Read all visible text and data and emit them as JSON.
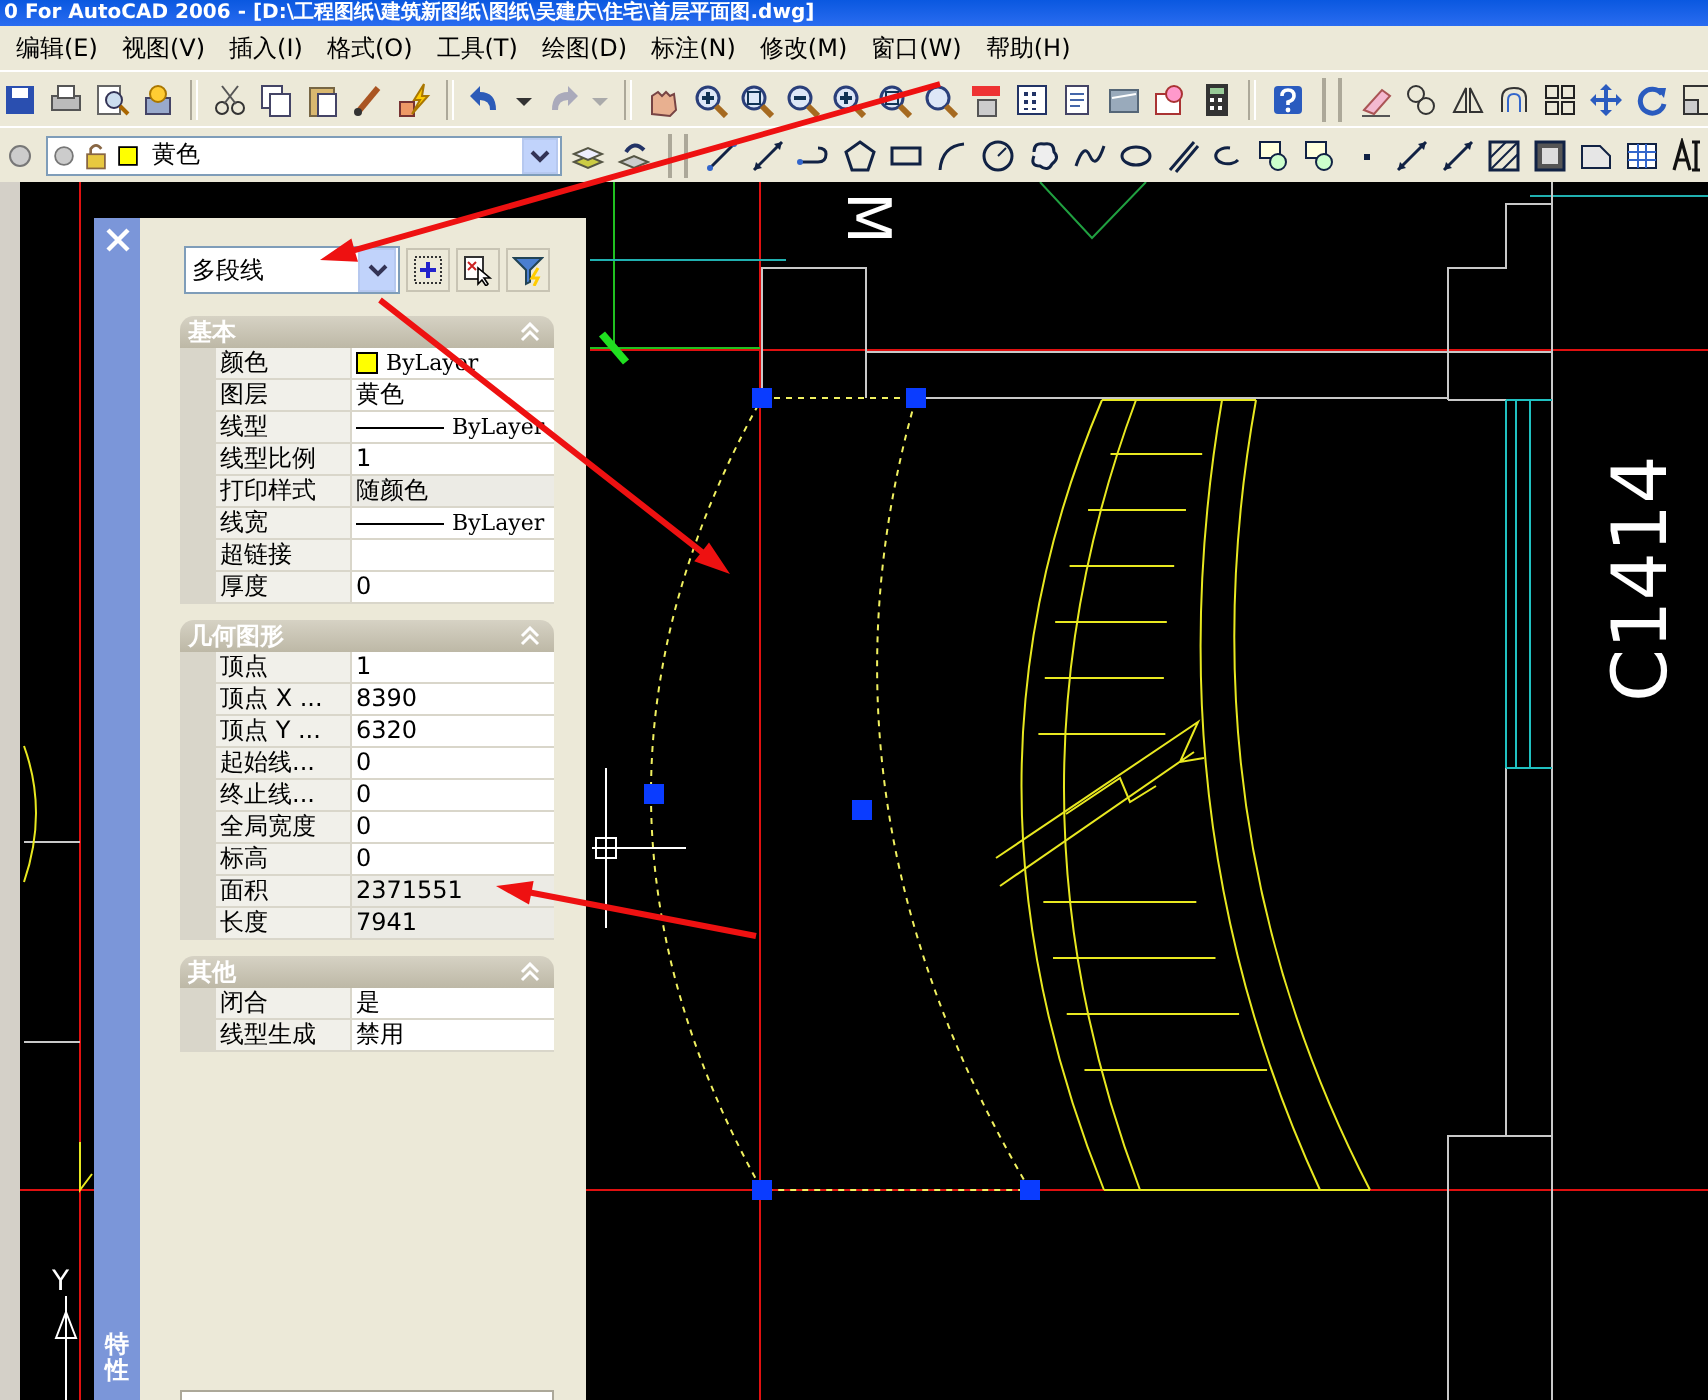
{
  "window": {
    "title": "0 For AutoCAD 2006 - [D:\\工程图纸\\建筑新图纸\\图纸\\吴建庆\\住宅\\首层平面图.dwg]"
  },
  "menu": [
    {
      "label": "编辑(E)"
    },
    {
      "label": "视图(V)"
    },
    {
      "label": "插入(I)"
    },
    {
      "label": "格式(O)"
    },
    {
      "label": "工具(T)"
    },
    {
      "label": "绘图(D)"
    },
    {
      "label": "标注(N)"
    },
    {
      "label": "修改(M)"
    },
    {
      "label": "窗口(W)"
    },
    {
      "label": "帮助(H)"
    }
  ],
  "layer_control": {
    "value": "黄色"
  },
  "properties": {
    "title": "特性",
    "object_type": "多段线",
    "sections": [
      {
        "title": "基本",
        "expanded": true,
        "rows": [
          {
            "label": "颜色",
            "value": "ByLayer",
            "kind": "color",
            "disabled": false
          },
          {
            "label": "图层",
            "value": "黄色",
            "kind": "text",
            "disabled": false
          },
          {
            "label": "线型",
            "value": "ByLayer",
            "kind": "line",
            "disabled": false
          },
          {
            "label": "线型比例",
            "value": "1",
            "kind": "text",
            "disabled": false
          },
          {
            "label": "打印样式",
            "value": "随颜色",
            "kind": "text",
            "disabled": true
          },
          {
            "label": "线宽",
            "value": "ByLayer",
            "kind": "line",
            "disabled": false
          },
          {
            "label": "超链接",
            "kind": "text",
            "disabled": false
          },
          {
            "label": "厚度",
            "value": "0",
            "kind": "text",
            "disabled": false
          }
        ]
      },
      {
        "title": "几何图形",
        "expanded": true,
        "rows": [
          {
            "label": "顶点",
            "value": "1",
            "kind": "text",
            "disabled": false
          },
          {
            "label": "顶点 X ...",
            "value": "8390",
            "kind": "text",
            "disabled": false
          },
          {
            "label": "顶点 Y ...",
            "value": "6320",
            "kind": "text",
            "disabled": false
          },
          {
            "label": "起始线...",
            "value": "0",
            "kind": "text",
            "disabled": false
          },
          {
            "label": "终止线...",
            "value": "0",
            "kind": "text",
            "disabled": false
          },
          {
            "label": "全局宽度",
            "value": "0",
            "kind": "text",
            "disabled": false
          },
          {
            "label": "标高",
            "value": "0",
            "kind": "text",
            "disabled": false
          },
          {
            "label": "面积",
            "value": "2371551",
            "kind": "text",
            "disabled": true
          },
          {
            "label": "长度",
            "value": "7941",
            "kind": "text",
            "disabled": true
          }
        ]
      },
      {
        "title": "其他",
        "expanded": true,
        "rows": [
          {
            "label": "闭合",
            "value": "是",
            "kind": "text",
            "disabled": false
          },
          {
            "label": "线型生成",
            "value": "禁用",
            "kind": "text",
            "disabled": false
          }
        ]
      }
    ]
  },
  "canvas": {
    "labels": [
      {
        "kind": "rotated-cw",
        "text": "M"
      },
      {
        "kind": "rotated-ccw",
        "text": "C1414"
      },
      {
        "kind": "upright",
        "text": "Y"
      }
    ]
  }
}
